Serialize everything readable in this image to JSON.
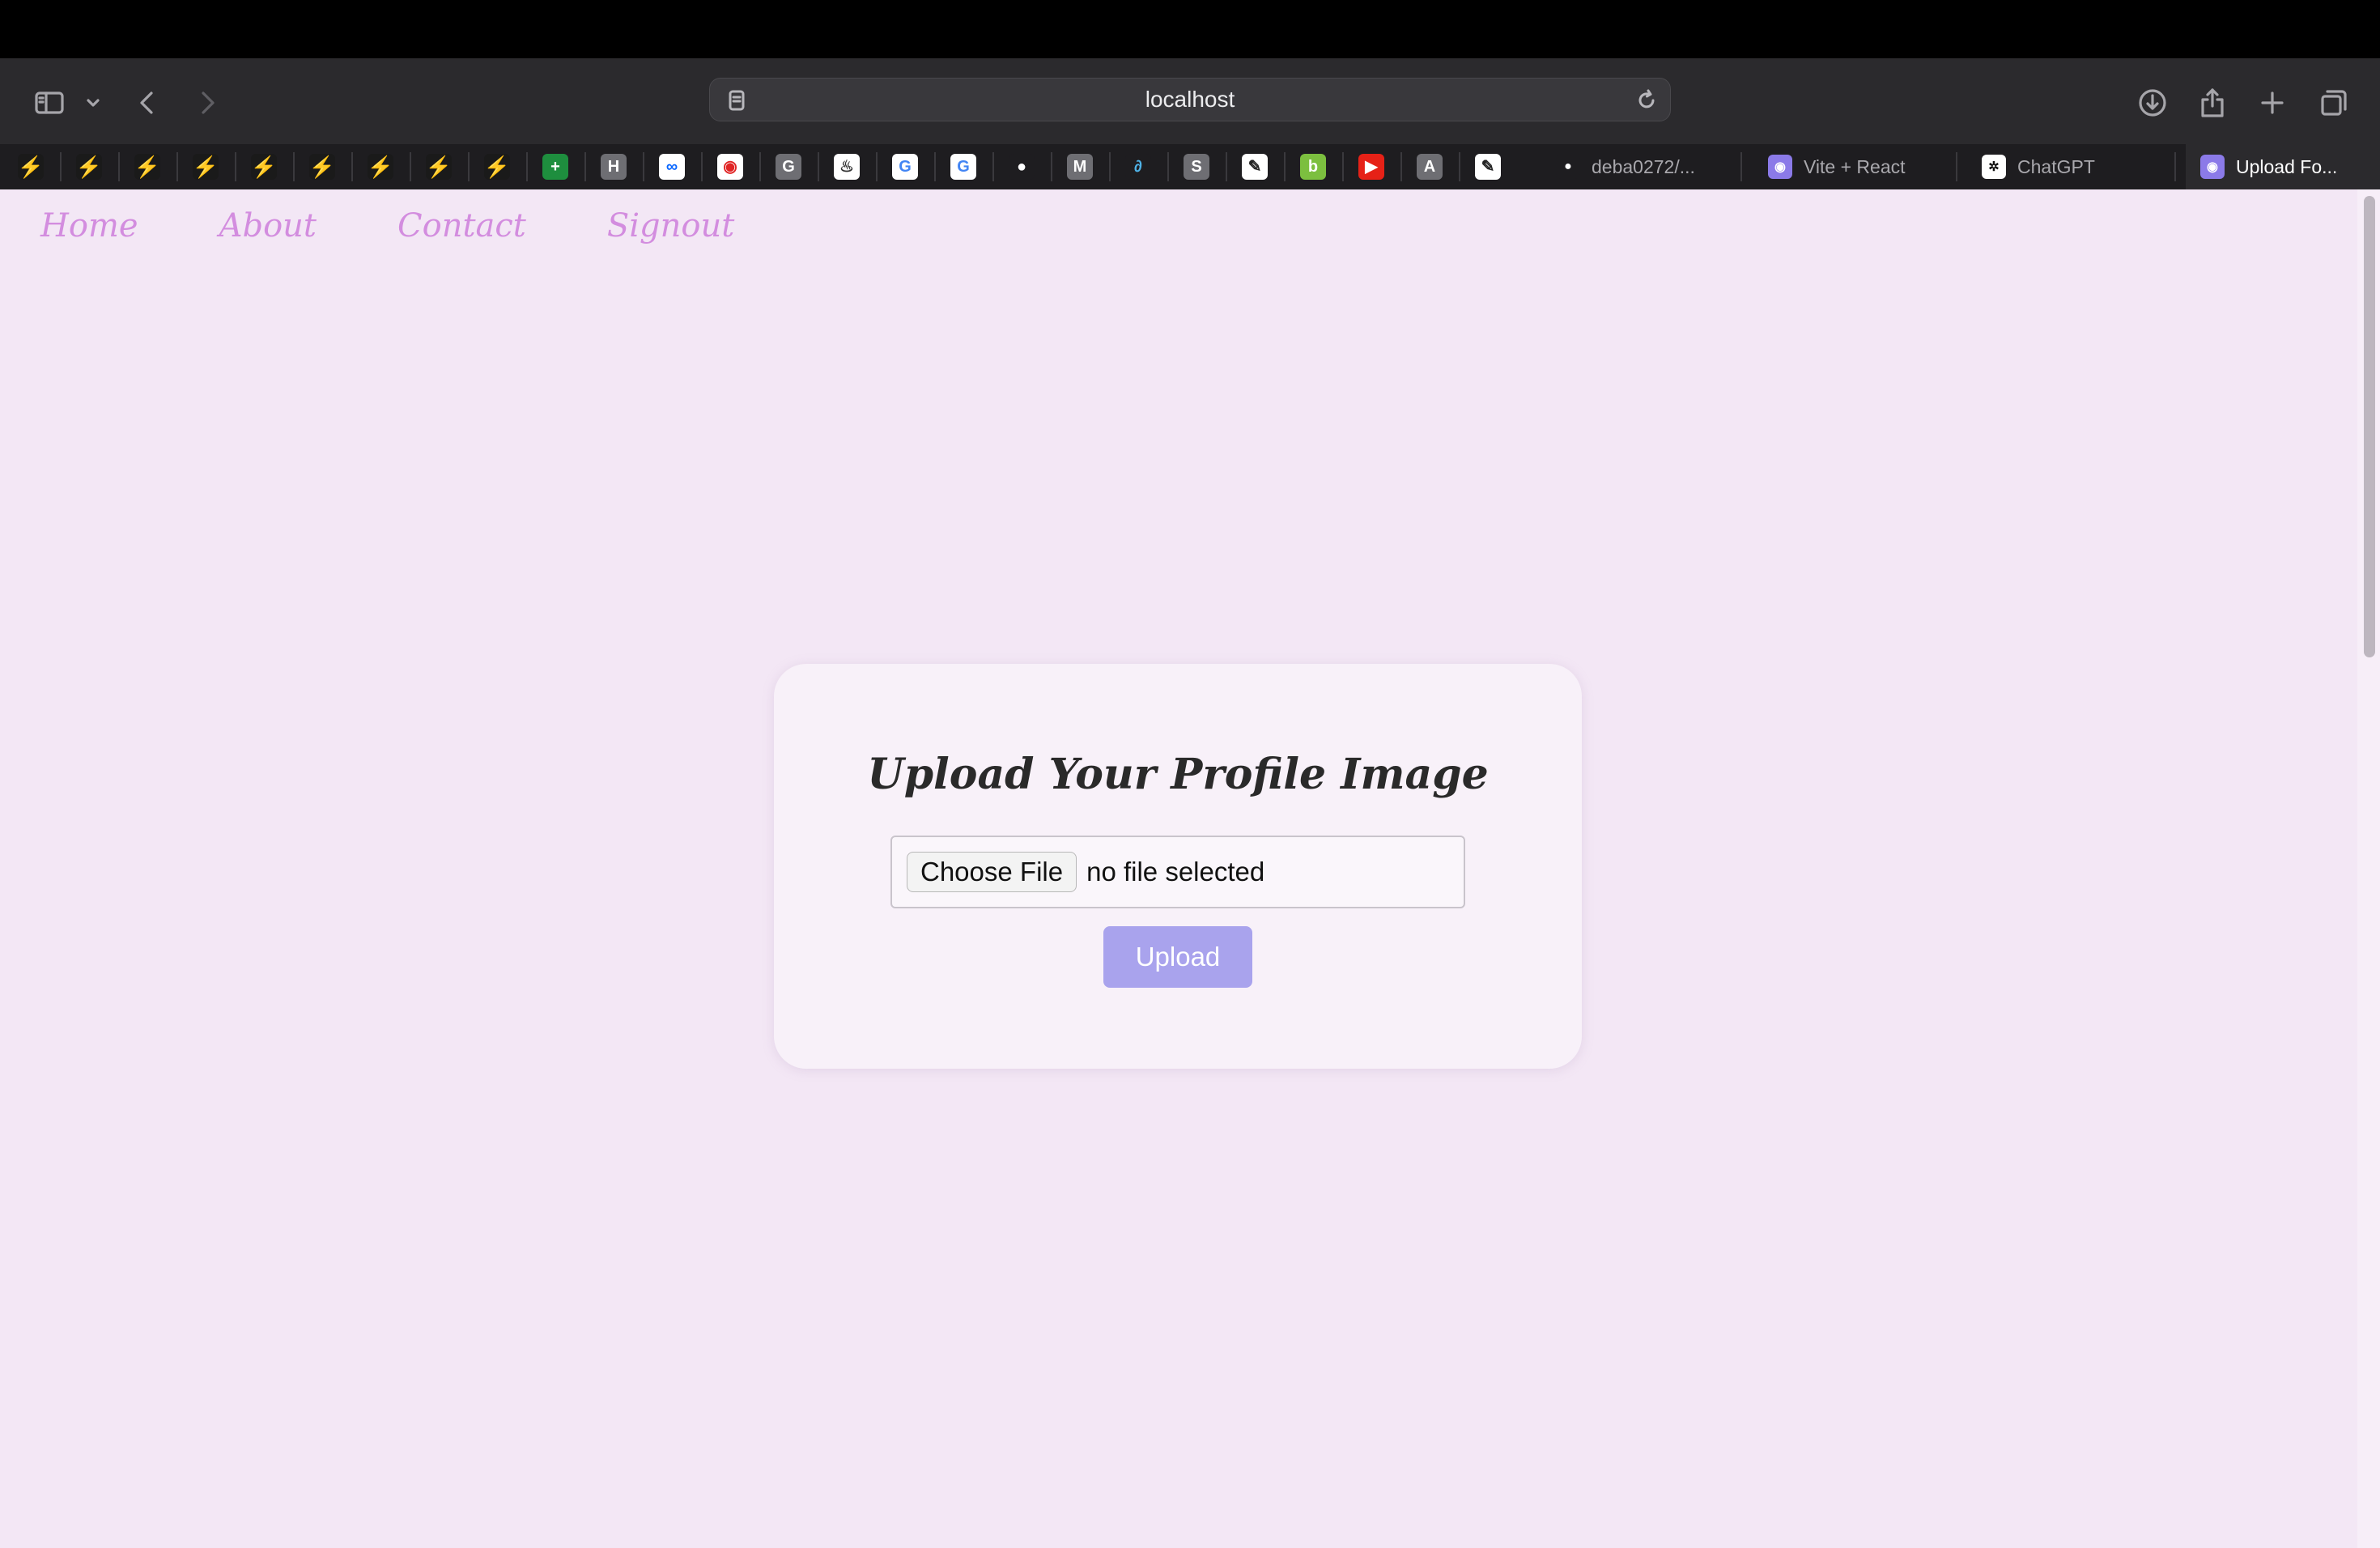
{
  "browser": {
    "url": "localhost",
    "pinned_favicons": [
      {
        "icon": "lightning-icon",
        "glyph": "⚡",
        "bg": "#1a1a1a",
        "fg": "#f2a62a"
      },
      {
        "icon": "lightning-icon",
        "glyph": "⚡",
        "bg": "#1a1a1a",
        "fg": "#f2a62a"
      },
      {
        "icon": "lightning-icon",
        "glyph": "⚡",
        "bg": "#1a1a1a",
        "fg": "#f2a62a"
      },
      {
        "icon": "lightning-icon",
        "glyph": "⚡",
        "bg": "#1a1a1a",
        "fg": "#f2a62a"
      },
      {
        "icon": "lightning-icon",
        "glyph": "⚡",
        "bg": "#1a1a1a",
        "fg": "#f2a62a"
      },
      {
        "icon": "lightning-icon",
        "glyph": "⚡",
        "bg": "#1a1a1a",
        "fg": "#f2a62a"
      },
      {
        "icon": "lightning-icon",
        "glyph": "⚡",
        "bg": "#1a1a1a",
        "fg": "#f2a62a"
      },
      {
        "icon": "lightning-icon",
        "glyph": "⚡",
        "bg": "#1a1a1a",
        "fg": "#f2a62a"
      },
      {
        "icon": "lightning-icon",
        "glyph": "⚡",
        "bg": "#1a1a1a",
        "fg": "#f2a62a"
      },
      {
        "icon": "sheets-icon",
        "glyph": "+",
        "bg": "#1e8e3e",
        "fg": "#ffffff"
      },
      {
        "icon": "h-icon",
        "glyph": "H",
        "bg": "#6e6e73",
        "fg": "#ffffff"
      },
      {
        "icon": "meta-icon",
        "glyph": "∞",
        "bg": "#ffffff",
        "fg": "#0866ff"
      },
      {
        "icon": "signal-icon",
        "glyph": "◉",
        "bg": "#ffffff",
        "fg": "#e02424"
      },
      {
        "icon": "g-icon",
        "glyph": "G",
        "bg": "#6e6e73",
        "fg": "#ffffff"
      },
      {
        "icon": "bike-icon",
        "glyph": "♨",
        "bg": "#ffffff",
        "fg": "#333333"
      },
      {
        "icon": "google-icon",
        "glyph": "G",
        "bg": "#ffffff",
        "fg": "#4285f4"
      },
      {
        "icon": "google-icon",
        "glyph": "G",
        "bg": "#ffffff",
        "fg": "#4285f4"
      },
      {
        "icon": "github-icon",
        "glyph": "●",
        "bg": "#1e1d20",
        "fg": "#ffffff"
      },
      {
        "icon": "m-icon",
        "glyph": "M",
        "bg": "#6e6e73",
        "fg": "#ffffff"
      },
      {
        "icon": "link-icon",
        "glyph": "∂",
        "bg": "#1e1d20",
        "fg": "#4fb3e8"
      },
      {
        "icon": "s-icon",
        "glyph": "S",
        "bg": "#6e6e73",
        "fg": "#ffffff"
      },
      {
        "icon": "pen-icon",
        "glyph": "✎",
        "bg": "#ffffff",
        "fg": "#222222"
      },
      {
        "icon": "leaf-icon",
        "glyph": "b",
        "bg": "#7cbf3f",
        "fg": "#ffffff"
      },
      {
        "icon": "youtube-icon",
        "glyph": "▶",
        "bg": "#e62117",
        "fg": "#ffffff"
      },
      {
        "icon": "a-icon",
        "glyph": "A",
        "bg": "#6e6e73",
        "fg": "#ffffff"
      },
      {
        "icon": "pen-icon",
        "glyph": "✎",
        "bg": "#ffffff",
        "fg": "#222222"
      }
    ],
    "tabs": [
      {
        "title": "deba0272/...",
        "icon": "github-icon",
        "glyph": "●",
        "bg": "#1e1d20",
        "fg": "#ffffff",
        "active": false
      },
      {
        "title": "Vite + React",
        "icon": "vite-icon",
        "glyph": "◉",
        "bg": "#8b7ae8",
        "fg": "#ffffff",
        "active": false
      },
      {
        "title": "ChatGPT",
        "icon": "chatgpt-icon",
        "glyph": "✲",
        "bg": "#ffffff",
        "fg": "#111111",
        "active": false
      },
      {
        "title": "Upload Fo...",
        "icon": "vite-icon",
        "glyph": "◉",
        "bg": "#8b7ae8",
        "fg": "#ffffff",
        "active": true
      }
    ]
  },
  "nav": {
    "home": "Home",
    "about": "About",
    "contact": "Contact",
    "signout": "Signout"
  },
  "upload_card": {
    "title": "Upload Your Profile Image",
    "choose_label": "Choose File",
    "file_status": "no file selected",
    "upload_label": "Upload"
  },
  "colors": {
    "page_bg": "#f3e7f5",
    "nav_link": "#d38ddf",
    "upload_button": "#a9a3ed"
  }
}
